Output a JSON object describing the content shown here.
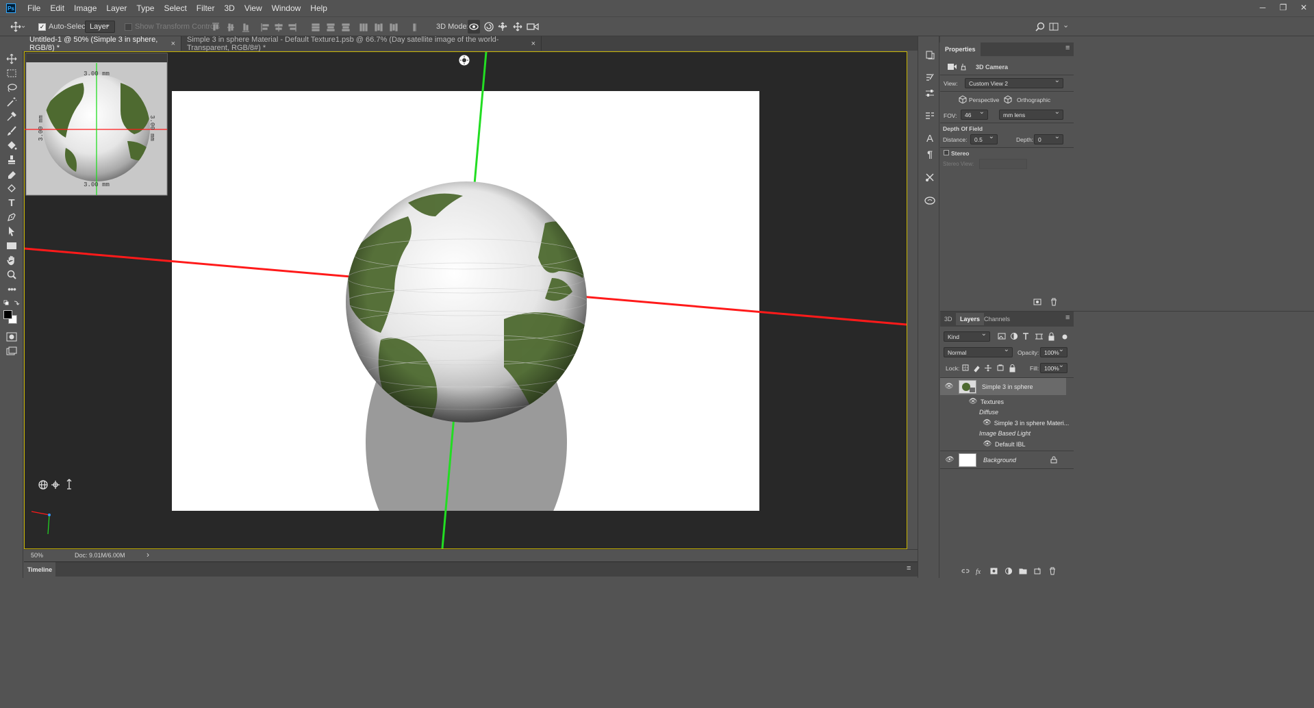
{
  "app": {
    "logo": "Ps"
  },
  "menu": [
    "File",
    "Edit",
    "Image",
    "Layer",
    "Type",
    "Select",
    "Filter",
    "3D",
    "View",
    "Window",
    "Help"
  ],
  "window_controls": [
    "─",
    "❐",
    "✕"
  ],
  "options_bar": {
    "auto_select_label": "Auto-Select:",
    "auto_select_checked": true,
    "auto_select_value": "Layer",
    "show_transform_label": "Show Transform Controls",
    "mode_label": "3D Mode:"
  },
  "tabs": [
    {
      "label": "Untitled-1 @ 50% (Simple 3 in sphere, RGB/8) *",
      "close": "×",
      "active": true
    },
    {
      "label": "Simple 3 in sphere Material - Default Texture1.psb @ 66.7% (Day satellite image of the world- Transparent, RGB/8#) *",
      "close": "×",
      "active": false
    }
  ],
  "mini_view": {
    "dim_top": "3.00 mm",
    "dim_bottom": "3.00 mm",
    "dim_left": "3.00 mm",
    "dim_right": "3.00 mm"
  },
  "status": {
    "zoom": "50%",
    "doc": "Doc: 9.01M/6.00M",
    "arrow": "›"
  },
  "timeline": {
    "label": "Timeline"
  },
  "properties": {
    "title": "Properties",
    "section": "3D Camera",
    "view_label": "View:",
    "view_value": "Custom View 2",
    "perspective_label": "Perspective",
    "orthographic_label": "Orthographic",
    "fov_label": "FOV:",
    "fov_value": "46",
    "fov_unit": "mm lens",
    "dof_label": "Depth Of Field",
    "distance_label": "Distance:",
    "distance_value": "0.5",
    "depth_label": "Depth:",
    "depth_value": "0",
    "stereo_label": "Stereo",
    "stereo_view_label": "Stereo View:"
  },
  "layers_panel": {
    "tabs": [
      "3D",
      "Layers",
      "Channels"
    ],
    "active_tab": "Layers",
    "filter_kind": "Kind",
    "blend_mode": "Normal",
    "opacity_label": "Opacity:",
    "opacity_value": "100%",
    "lock_label": "Lock:",
    "fill_label": "Fill:",
    "fill_value": "100%",
    "layers": [
      {
        "name": "Simple 3 in sphere",
        "visible": true,
        "selected": true
      },
      {
        "name": "Textures"
      },
      {
        "name": "Diffuse"
      },
      {
        "name": "Simple 3 in sphere Materi..."
      },
      {
        "name": "Image Based Light"
      },
      {
        "name": "Default IBL"
      },
      {
        "name": "Background",
        "visible": true,
        "locked": true
      }
    ]
  },
  "colors": {
    "app_bg": "#535353",
    "panel_dark": "#424242",
    "canvas_bg": "#282828",
    "canvas_border": "#c8b400",
    "axis_x": "#ff1a1a",
    "axis_y": "#22dd22",
    "ocean": "#e8e8e8",
    "land": "#4e6a30"
  }
}
